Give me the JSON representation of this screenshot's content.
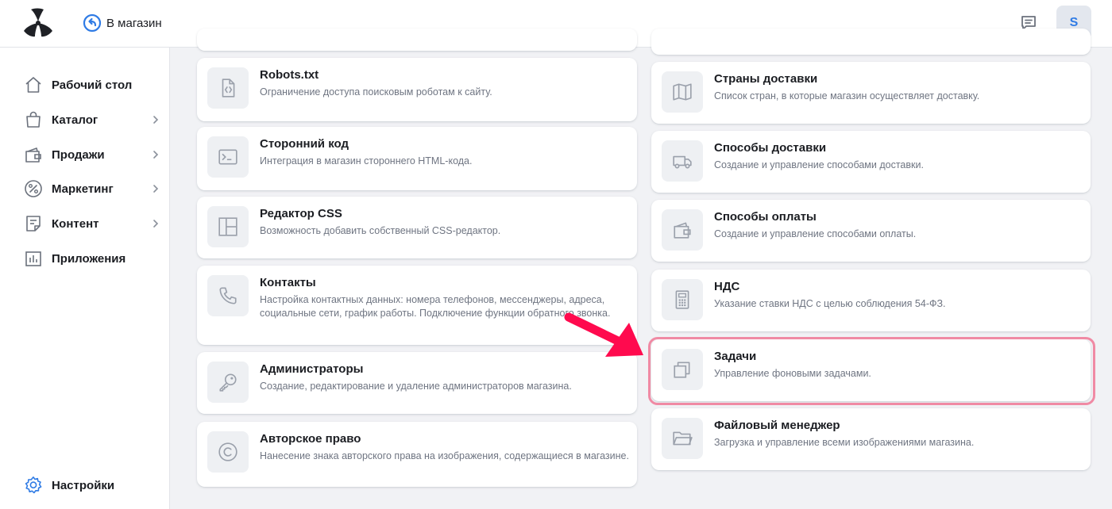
{
  "header": {
    "back_label": "В магазин",
    "avatar_letter": "S"
  },
  "sidebar": {
    "items": [
      {
        "label": "Рабочий стол",
        "icon": "home-icon",
        "has_submenu": false
      },
      {
        "label": "Каталог",
        "icon": "bag-icon",
        "has_submenu": true
      },
      {
        "label": "Продажи",
        "icon": "wallet-icon",
        "has_submenu": true
      },
      {
        "label": "Маркетинг",
        "icon": "percent-icon",
        "has_submenu": true
      },
      {
        "label": "Контент",
        "icon": "document-icon",
        "has_submenu": true
      },
      {
        "label": "Приложения",
        "icon": "chart-icon",
        "has_submenu": false
      }
    ],
    "settings_label": "Настройки"
  },
  "cards_left": [
    {
      "title": "Robots.txt",
      "desc": "Ограничение доступа поисковым роботам к сайту.",
      "icon": "code-file-icon"
    },
    {
      "title": "Сторонний код",
      "desc": "Интеграция в магазин стороннего HTML-кода.",
      "icon": "terminal-icon"
    },
    {
      "title": "Редактор CSS",
      "desc": "Возможность добавить собственный CSS-редактор.",
      "icon": "layout-icon"
    },
    {
      "title": "Контакты",
      "desc": "Настройка контактных данных: номера телефонов, мессенджеры, адреса, социальные сети, график работы. Подключение функции обратного звонка.",
      "icon": "phone-icon"
    },
    {
      "title": "Администраторы",
      "desc": "Создание, редактирование и удаление администраторов магазина.",
      "icon": "key-icon"
    },
    {
      "title": "Авторское право",
      "desc": "Нанесение знака авторского права на изображения, содержащиеся в магазине.",
      "icon": "copyright-icon"
    }
  ],
  "cards_right": [
    {
      "title": "Страны доставки",
      "desc": "Список стран, в которые магазин осуществляет доставку.",
      "icon": "map-icon"
    },
    {
      "title": "Способы доставки",
      "desc": "Создание и управление способами доставки.",
      "icon": "truck-icon"
    },
    {
      "title": "Способы оплаты",
      "desc": "Создание и управление способами оплаты.",
      "icon": "wallet-icon"
    },
    {
      "title": "НДС",
      "desc": "Указание ставки НДС с целью соблюдения 54-ФЗ.",
      "icon": "calculator-icon"
    },
    {
      "title": "Задачи",
      "desc": "Управление фоновыми задачами.",
      "icon": "copy-icon"
    },
    {
      "title": "Файловый менеджер",
      "desc": "Загрузка и управление всеми изображениями магазина.",
      "icon": "folder-icon"
    }
  ],
  "colors": {
    "accent": "#2f7be5",
    "highlight": "#f08aa4",
    "arrow": "#ff0a4e",
    "icon_gray": "#9aa0ab"
  }
}
